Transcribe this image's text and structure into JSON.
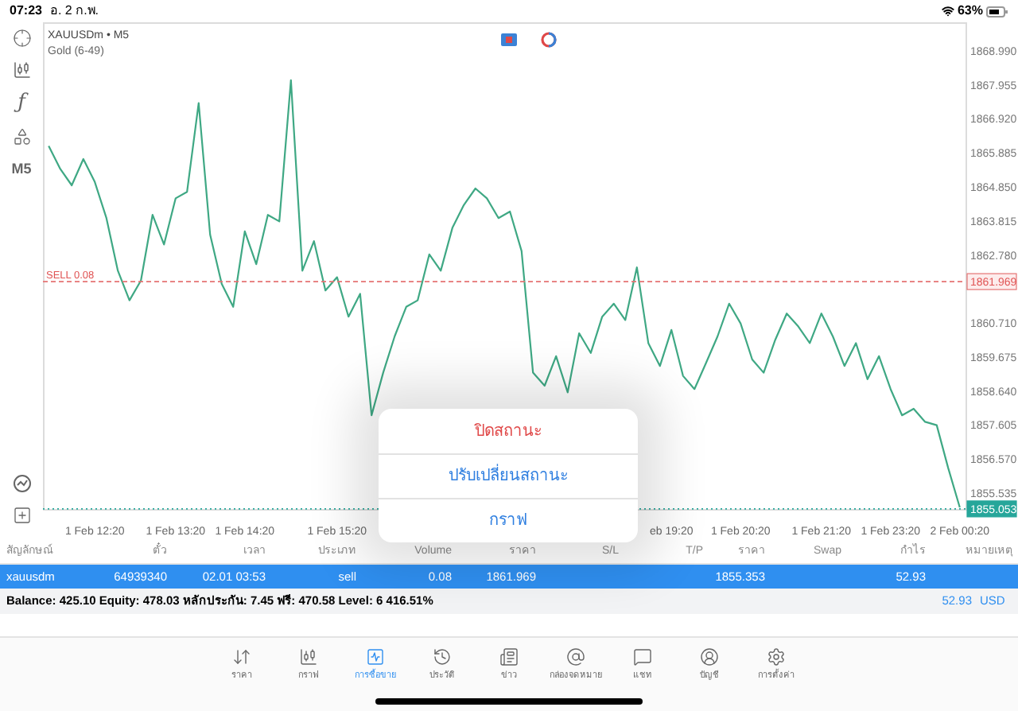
{
  "status_bar": {
    "time": "07:23",
    "date": "อ. 2 ก.พ.",
    "battery": "63%"
  },
  "left_toolbar": {
    "function_label": "ƒ",
    "timeframe": "M5"
  },
  "chart": {
    "symbol_label": "XAUUSDm • M5",
    "indicator_label": "Gold (6-49)",
    "chart_data": {
      "type": "line",
      "ylim": [
        1855.05,
        1869.86
      ],
      "categories": [
        null,
        null,
        null,
        null,
        "1 Feb 12:20",
        null,
        null,
        null,
        null,
        null,
        null,
        "1 Feb 13:20",
        null,
        null,
        null,
        null,
        null,
        "1 Feb 14:20",
        null,
        null,
        null,
        null,
        null,
        null,
        null,
        "1 Feb 15:20",
        null,
        null,
        null,
        null,
        null,
        null,
        null,
        null,
        null,
        null,
        null,
        null,
        null,
        null,
        null,
        null,
        null,
        null,
        null,
        null,
        null,
        null,
        null,
        null,
        null,
        null,
        null,
        null,
        "eb 19:20",
        null,
        null,
        null,
        null,
        null,
        "1 Feb 20:20",
        null,
        null,
        null,
        null,
        null,
        null,
        "1 Feb 21:20",
        null,
        null,
        null,
        null,
        null,
        "1 Feb 23:20",
        null,
        null,
        null,
        null,
        null,
        "2 Feb 00:20"
      ],
      "yticks": [
        {
          "value": 1868.99,
          "label": "1868.990"
        },
        {
          "value": 1867.955,
          "label": "1867.955"
        },
        {
          "value": 1866.92,
          "label": "1866.920"
        },
        {
          "value": 1865.885,
          "label": "1865.885"
        },
        {
          "value": 1864.85,
          "label": "1864.850"
        },
        {
          "value": 1863.815,
          "label": "1863.815"
        },
        {
          "value": 1862.78,
          "label": "1862.780"
        },
        {
          "value": 1860.71,
          "label": "1860.710"
        },
        {
          "value": 1859.675,
          "label": "1859.675"
        },
        {
          "value": 1858.64,
          "label": "1858.640"
        },
        {
          "value": 1857.605,
          "label": "1857.605"
        },
        {
          "value": 1856.57,
          "label": "1856.570"
        },
        {
          "value": 1855.535,
          "label": "1855.535"
        }
      ],
      "series": [
        {
          "color": "#3fa884",
          "values": [
            1866.1,
            1865.4,
            1864.9,
            1865.7,
            1865.0,
            1863.9,
            1862.3,
            1861.4,
            1862.0,
            1864.0,
            1863.1,
            1864.5,
            1864.7,
            1867.4,
            1863.4,
            1861.9,
            1861.2,
            1863.5,
            1862.5,
            1864.0,
            1863.8,
            1868.1,
            1862.3,
            1863.2,
            1861.7,
            1862.1,
            1860.9,
            1861.6,
            1857.9,
            1859.2,
            1860.3,
            1861.2,
            1861.4,
            1862.8,
            1862.3,
            1863.6,
            1864.3,
            1864.8,
            1864.5,
            1863.9,
            1864.1,
            1862.9,
            1859.2,
            1858.8,
            1859.7,
            1858.6,
            1860.4,
            1859.8,
            1860.9,
            1861.3,
            1860.8,
            1862.4,
            1860.1,
            1859.4,
            1860.5,
            1859.1,
            1858.7,
            1859.5,
            1860.3,
            1861.3,
            1860.7,
            1859.6,
            1859.2,
            1860.2,
            1861.0,
            1860.6,
            1860.1,
            1861.0,
            1860.3,
            1859.4,
            1860.1,
            1859.0,
            1859.7,
            1858.7,
            1857.9,
            1858.1,
            1857.7,
            1857.6,
            1856.3,
            1855.1
          ]
        }
      ],
      "ylabel": null
    },
    "price_lines": [
      {
        "kind": "order",
        "label": "SELL 0.08",
        "price": "1861.969"
      },
      {
        "kind": "bid",
        "price": "1855.053"
      }
    ]
  },
  "popup_menu": {
    "items": [
      {
        "label": "ปิดสถานะ",
        "kind": "destructive"
      },
      {
        "label": "ปรับเปลี่ยนสถานะ",
        "kind": "default"
      },
      {
        "label": "กราฟ",
        "kind": "default"
      }
    ]
  },
  "table": {
    "columns": [
      "สัญลักษณ์",
      "ตั๋ว",
      "เวลา",
      "ประเภท",
      "Volume",
      "ราคา",
      "S/L",
      "T/P",
      "ราคา",
      "Swap",
      "กำไร",
      "หมายเหตุ"
    ],
    "rows": [
      {
        "selected": true,
        "cells": [
          "xauusdm",
          "64939340",
          "02.01 03:53",
          "sell",
          "0.08",
          "1861.969",
          null,
          null,
          "1855.353",
          null,
          "52.93",
          null
        ]
      }
    ]
  },
  "summary": {
    "text": "Balance: 425.10 Equity: 478.03 หลักประกัน: 7.45 ฟรี: 470.58 Level: 6 416.51%",
    "profit": "52.93",
    "currency": "USD"
  },
  "tab_bar": [
    {
      "label": "ราคา",
      "selected": false
    },
    {
      "label": "กราฟ",
      "selected": false
    },
    {
      "label": "การซื้อขาย",
      "selected": true
    },
    {
      "label": "ประวัติ",
      "selected": false
    },
    {
      "label": "ข่าว",
      "selected": false
    },
    {
      "label": "กล่องจดหมาย",
      "selected": false
    },
    {
      "label": "แชท",
      "selected": false
    },
    {
      "label": "บัญชี",
      "selected": false
    },
    {
      "label": "การตั้งค่า",
      "selected": false
    }
  ]
}
